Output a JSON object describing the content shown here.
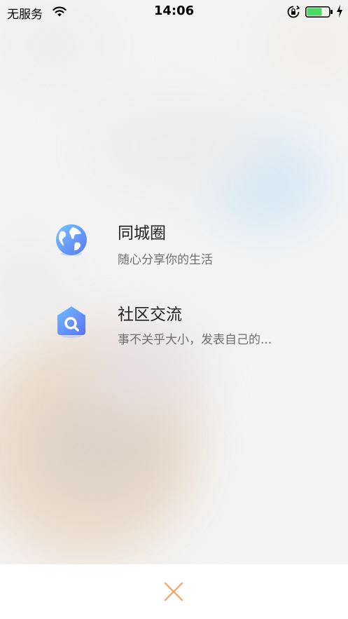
{
  "status_bar": {
    "carrier": "无服务",
    "time": "14:06",
    "battery_level": 0.7
  },
  "menu": {
    "items": [
      {
        "title": "同城圈",
        "subtitle": "随心分享你的生活",
        "icon": "globe-icon"
      },
      {
        "title": "社区交流",
        "subtitle": "事不关乎大小，发表自己的...",
        "icon": "community-house-icon"
      }
    ]
  },
  "bottom_bar": {
    "close_icon": "close-icon",
    "accent_color": "#f5a25d"
  },
  "colors": {
    "icon_gradient_start": "#6fb8ff",
    "icon_gradient_end": "#5b7cf5"
  }
}
